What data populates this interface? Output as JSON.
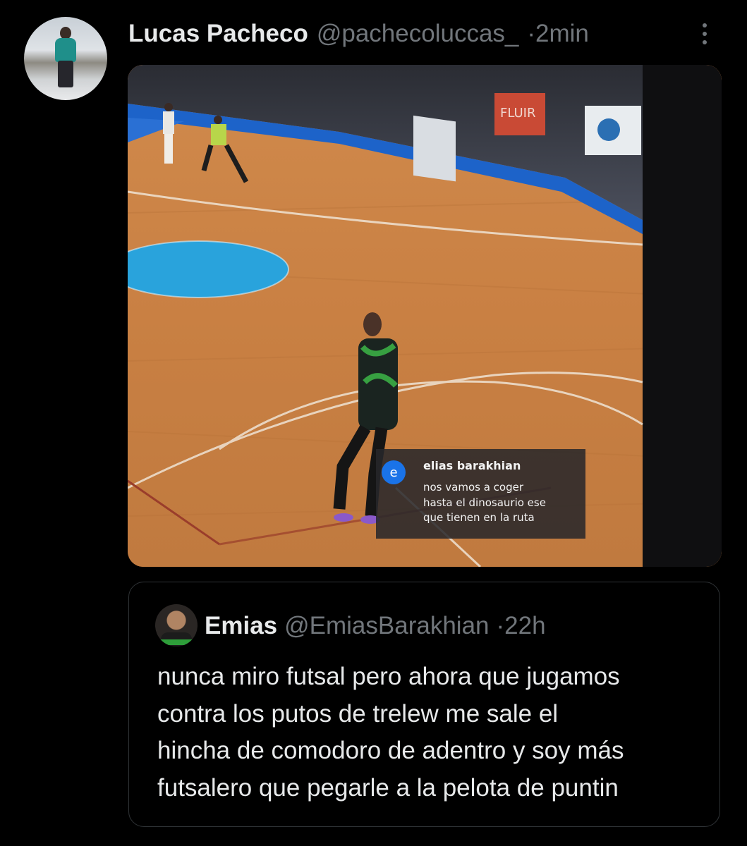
{
  "tweet": {
    "author_name": "Lucas Pacheco",
    "handle": "@pachecoluccas_",
    "separator": "·",
    "time": "2min"
  },
  "media": {
    "banner_text": "FLUIR",
    "caption": {
      "avatar_letter": "e",
      "name": "elias barakhian",
      "lines": [
        "nos vamos a coger",
        "hasta el dinosaurio ese",
        "que tienen en la ruta"
      ]
    }
  },
  "quote": {
    "author_name": "Emias",
    "handle": "@EmiasBarakhian",
    "separator": "·",
    "time": "22h",
    "lines": [
      "nunca miro futsal pero ahora que jugamos",
      "contra los putos de trelew me sale el",
      "hincha de comodoro de adentro y soy más",
      "futsalero que pegarle a la pelota de puntin"
    ]
  },
  "colors": {
    "background": "#000000",
    "text": "#e7e9ea",
    "muted": "#71767b",
    "border": "#2f3336",
    "caption_avatar": "#1a73e8"
  },
  "icons": [
    "more-options-icon"
  ]
}
